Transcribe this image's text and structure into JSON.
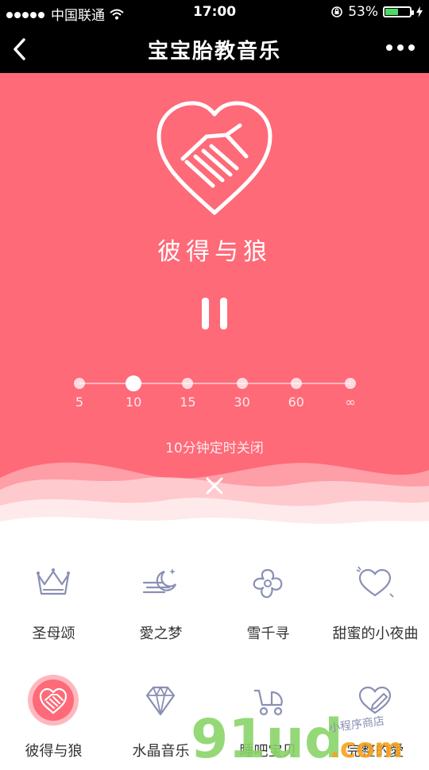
{
  "status_bar": {
    "carrier": "中国联通",
    "time": "17:00",
    "battery": "53%",
    "battery_level": 0.53
  },
  "nav": {
    "title": "宝宝胎教音乐",
    "back_icon": "chevron-left-icon",
    "more_icon": "more-dots-icon"
  },
  "player": {
    "song_title": "彼得与狼",
    "logo_icon": "heart-handshake-icon",
    "pause_icon": "pause-icon",
    "timer_options": [
      "5",
      "10",
      "15",
      "30",
      "60",
      "∞"
    ],
    "timer_selected": "10",
    "timer_text": "10分钟定时关闭",
    "close_icon": "close-icon"
  },
  "playlist": [
    {
      "label": "圣母颂",
      "icon": "crown-icon"
    },
    {
      "label": "愛之梦",
      "icon": "moon-cloud-icon"
    },
    {
      "label": "雪千寻",
      "icon": "flower-icon"
    },
    {
      "label": "甜蜜的小夜曲",
      "icon": "heart-icon"
    },
    {
      "label": "彼得与狼",
      "icon": "heart-handshake-icon",
      "active": true
    },
    {
      "label": "水晶音乐",
      "icon": "diamond-icon"
    },
    {
      "label": "睡吧宝贝",
      "icon": "stroller-icon"
    },
    {
      "label": "完整的愛",
      "icon": "heart-pencil-icon"
    }
  ],
  "watermark": {
    "main": "91ud",
    "sub": ".com",
    "tag": "小程序商店"
  },
  "colors": {
    "accent": "#fe6a78",
    "icon": "#8a8fb3",
    "watermark_green": "#8ad46a",
    "watermark_orange": "#f7a21b"
  }
}
